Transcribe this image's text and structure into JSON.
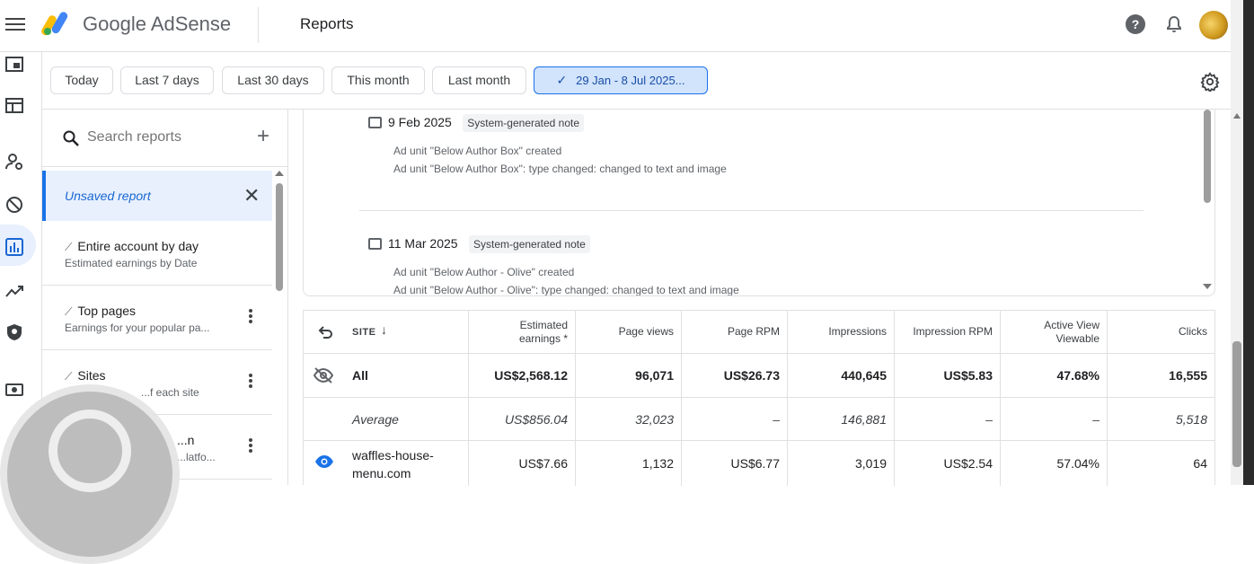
{
  "header": {
    "brand": "Google AdSense",
    "section": "Reports",
    "help_icon": "help-icon",
    "bell_icon": "notifications-icon",
    "menu_icon": "menu-icon",
    "colors": {
      "accent": "#1a73e8",
      "selected_chip_bg": "#d2e3fc"
    }
  },
  "rail": {
    "icons": [
      "overview-icon",
      "ads-icon",
      "sites-icon",
      "blocking-controls-icon",
      "reports-icon",
      "optimization-icon",
      "privacy-icon",
      "payments-icon"
    ],
    "active": "reports-icon"
  },
  "filters": {
    "chips": [
      {
        "label": "Today"
      },
      {
        "label": "Last 7 days"
      },
      {
        "label": "Last 30 days"
      },
      {
        "label": "This month"
      },
      {
        "label": "Last month"
      }
    ],
    "selected_range": "29 Jan - 8 Jul 2025...",
    "settings_icon": "gear-icon"
  },
  "reports_panel": {
    "search_placeholder": "Search reports",
    "unsaved_label": "Unsaved report",
    "items": [
      {
        "title": "Entire account by day",
        "subtitle": "Estimated earnings by Date"
      },
      {
        "title": "Top pages",
        "subtitle": "Earnings for your popular pa..."
      },
      {
        "title": "Sites",
        "subtitle": "...f each site"
      },
      {
        "title": "...n",
        "subtitle": "...latfo..."
      }
    ]
  },
  "notes": [
    {
      "date": "9 Feb 2025",
      "tag": "System-generated note",
      "lines": [
        "Ad unit \"Below Author Box\" created",
        "Ad unit \"Below Author Box\": type changed: changed to text and image"
      ]
    },
    {
      "date": "11 Mar 2025",
      "tag": "System-generated note",
      "lines": [
        "Ad unit \"Below Author - Olive\" created",
        "Ad unit \"Below Author - Olive\": type changed: changed to text and image"
      ]
    }
  ],
  "table": {
    "columns": {
      "site": "SITE",
      "earnings_1": "Estimated",
      "earnings_2": "earnings *",
      "page_views": "Page views",
      "page_rpm": "Page RPM",
      "impressions": "Impressions",
      "impression_rpm": "Impression RPM",
      "active_view_1": "Active View",
      "active_view_2": "Viewable",
      "clicks": "Clicks"
    },
    "all": {
      "site": "All",
      "earnings": "US$2,568.12",
      "page_views": "96,071",
      "page_rpm": "US$26.73",
      "impressions": "440,645",
      "impression_rpm": "US$5.83",
      "active_view": "47.68%",
      "clicks": "16,555"
    },
    "average": {
      "site": "Average",
      "earnings": "US$856.04",
      "page_views": "32,023",
      "page_rpm": "–",
      "impressions": "146,881",
      "impression_rpm": "–",
      "active_view": "–",
      "clicks": "5,518"
    },
    "rows": [
      {
        "site_1": "waffles-house-",
        "site_2": "menu.com",
        "earnings": "US$7.66",
        "page_views": "1,132",
        "page_rpm": "US$6.77",
        "impressions": "3,019",
        "impression_rpm": "US$2.54",
        "active_view": "57.04%",
        "clicks": "64"
      }
    ]
  }
}
